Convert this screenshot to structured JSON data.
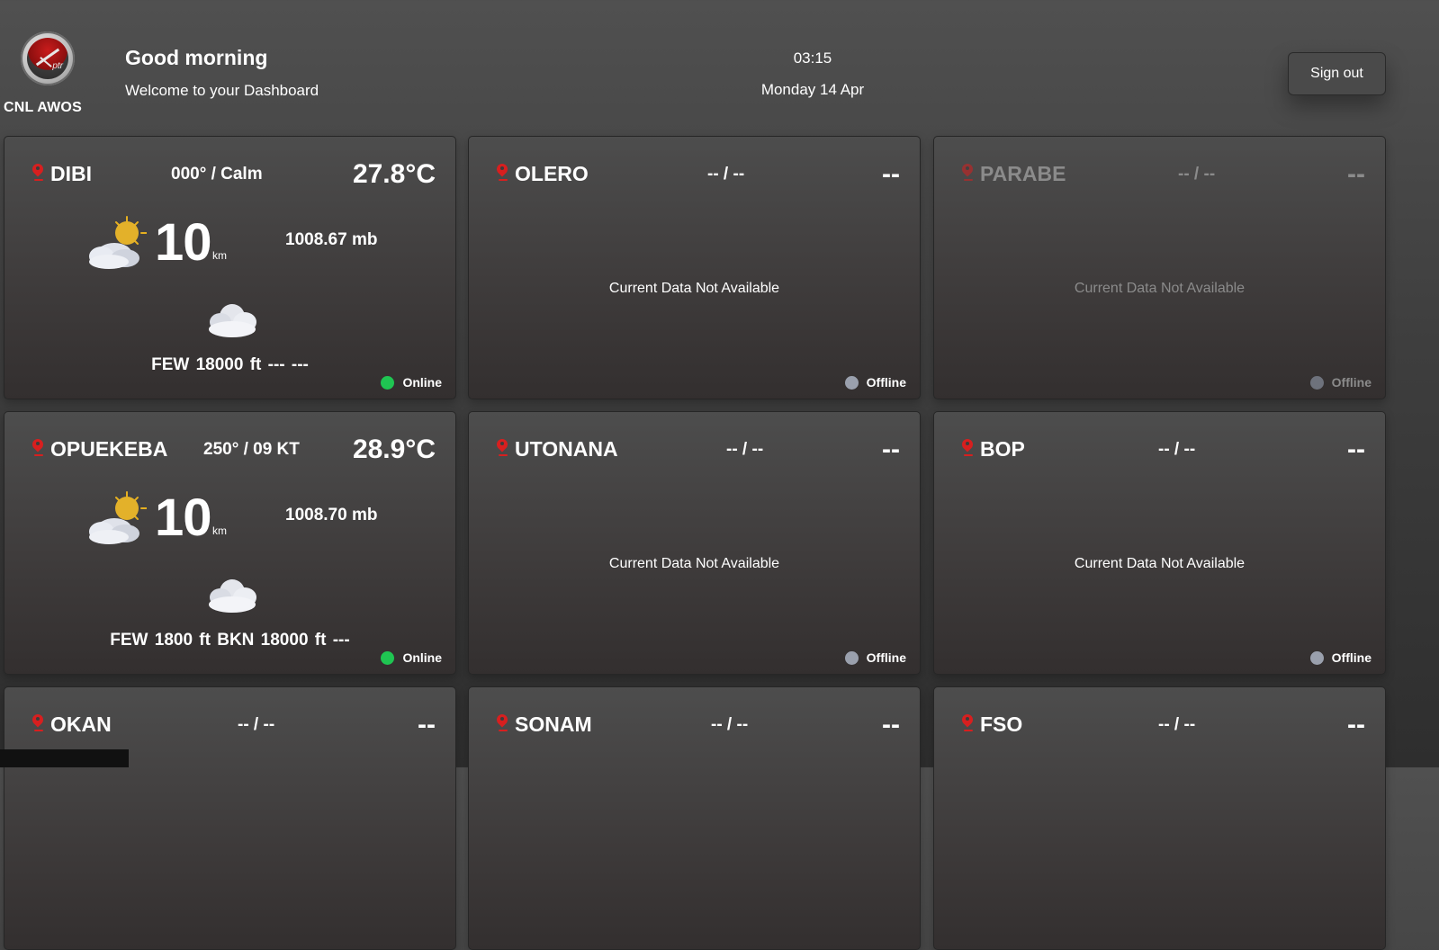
{
  "header": {
    "brand": "CNL AWOS",
    "logo_text": "ptr",
    "greeting": "Good morning",
    "welcome": "Welcome to your Dashboard",
    "time": "03:15",
    "date": "Monday 14 Apr",
    "signout_label": "Sign out"
  },
  "colors": {
    "online": "#1fc552",
    "offline": "#9aa0ad",
    "pin": "#d71f1f"
  },
  "stations": [
    {
      "name": "DIBI",
      "wind": "000° / Calm",
      "temp": "27.8°C",
      "visibility": "10",
      "vis_unit": "km",
      "pressure": "1008.67 mb",
      "clouds": "FEW 18000 ft  ---  ---",
      "status": "Online"
    },
    {
      "name": "OLERO",
      "wind": "-- / --",
      "temp": "--",
      "message": "Current Data Not Available",
      "status": "Offline"
    },
    {
      "name": "PARABE",
      "wind": "-- / --",
      "temp": "--",
      "message": "Current Data Not Available",
      "status": "Offline"
    },
    {
      "name": "OPUEKEBA",
      "wind": "250° / 09 KT",
      "temp": "28.9°C",
      "visibility": "10",
      "vis_unit": "km",
      "pressure": "1008.70 mb",
      "clouds": "FEW 1800 ft  BKN 18000 ft  ---",
      "status": "Online"
    },
    {
      "name": "UTONANA",
      "wind": "-- / --",
      "temp": "--",
      "message": "Current Data Not Available",
      "status": "Offline"
    },
    {
      "name": "BOP",
      "wind": "-- / --",
      "temp": "--",
      "message": "Current Data Not Available",
      "status": "Offline"
    },
    {
      "name": "OKAN",
      "wind": "-- / --",
      "temp": "--"
    },
    {
      "name": "SONAM",
      "wind": "-- / --",
      "temp": "--"
    },
    {
      "name": "FSO",
      "wind": "-- / --",
      "temp": "--"
    }
  ]
}
